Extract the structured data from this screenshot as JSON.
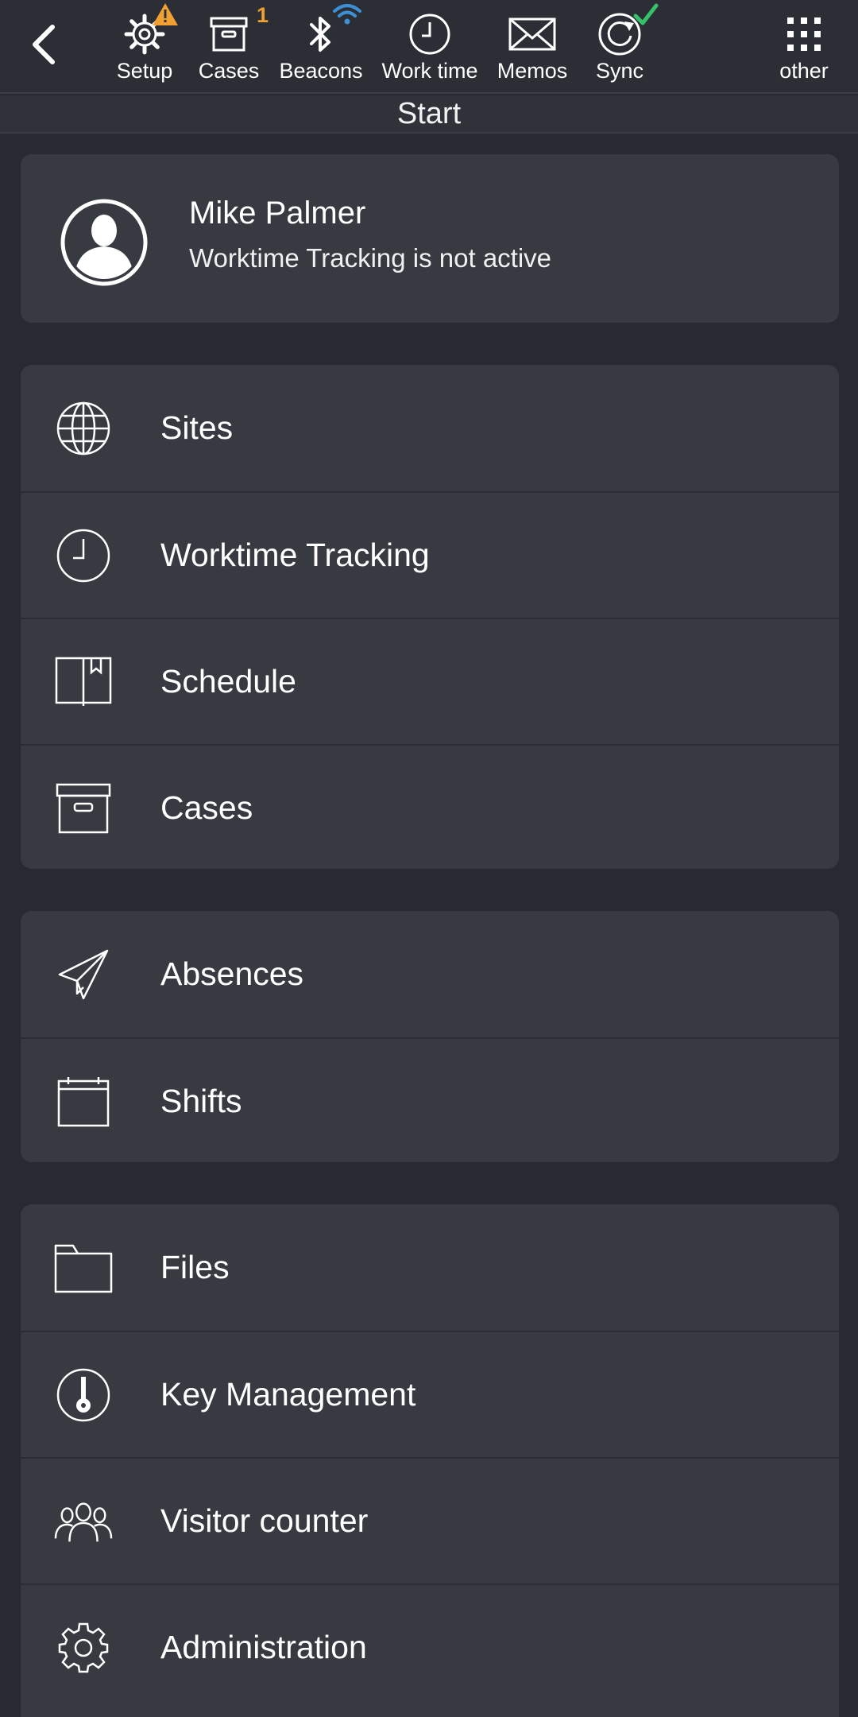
{
  "toolbar": {
    "items": [
      {
        "label": "Setup",
        "icon": "gear-icon",
        "badge": "warning"
      },
      {
        "label": "Cases",
        "icon": "archive-box-icon",
        "badge": "1"
      },
      {
        "label": "Beacons",
        "icon": "bluetooth-icon",
        "badge": "wifi"
      },
      {
        "label": "Work time",
        "icon": "clock-icon"
      },
      {
        "label": "Memos",
        "icon": "envelope-icon"
      },
      {
        "label": "Sync",
        "icon": "sync-icon",
        "badge": "check"
      },
      {
        "label": "other",
        "icon": "grid-icon"
      }
    ],
    "cases_count": "1"
  },
  "page_title": "Start",
  "profile": {
    "name": "Mike Palmer",
    "status": "Worktime Tracking is not active"
  },
  "menu": {
    "group1": [
      {
        "label": "Sites",
        "icon": "globe-icon"
      },
      {
        "label": "Worktime Tracking",
        "icon": "clock-icon"
      },
      {
        "label": "Schedule",
        "icon": "book-icon"
      },
      {
        "label": "Cases",
        "icon": "archive-box-icon"
      }
    ],
    "group2": [
      {
        "label": "Absences",
        "icon": "paper-plane-icon"
      },
      {
        "label": "Shifts",
        "icon": "calendar-icon"
      }
    ],
    "group3": [
      {
        "label": "Files",
        "icon": "folder-icon"
      },
      {
        "label": "Key Management",
        "icon": "key-icon"
      },
      {
        "label": "Visitor counter",
        "icon": "people-icon"
      },
      {
        "label": "Administration",
        "icon": "gear-icon"
      }
    ]
  },
  "colors": {
    "background": "#272a31",
    "card": "#373a41",
    "warning": "#f0a030",
    "wifi": "#3d8fd6",
    "check": "#35c06a"
  }
}
